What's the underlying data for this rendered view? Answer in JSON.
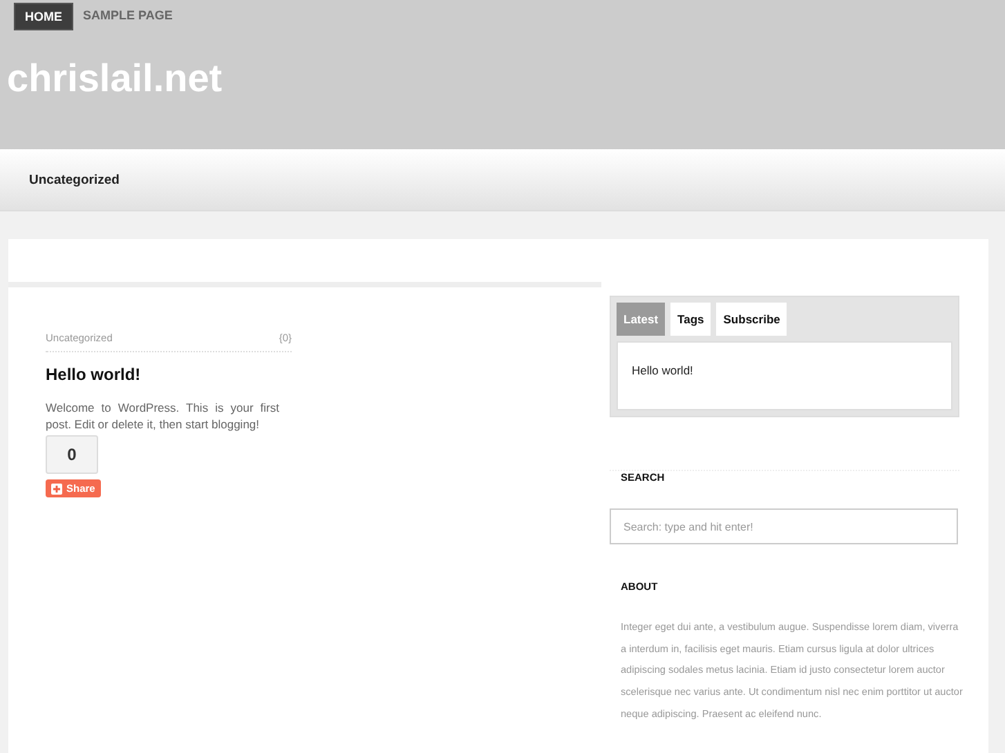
{
  "nav": [
    {
      "label": "HOME",
      "selected": true
    },
    {
      "label": "SAMPLE PAGE",
      "selected": false
    }
  ],
  "site_title": "chrislail.net",
  "category_bar": [
    "Uncategorized"
  ],
  "post": {
    "category": "Uncategorized",
    "comments": "{0}",
    "title": "Hello world!",
    "excerpt": "Welcome to WordPress. This is your first post. Edit or delete it, then start blogging!",
    "count": "0",
    "share": "Share"
  },
  "sidebar": {
    "tabs": [
      {
        "label": "Latest",
        "selected": true
      },
      {
        "label": "Tags",
        "selected": false
      },
      {
        "label": "Subscribe",
        "selected": false
      }
    ],
    "latest": [
      "Hello world!"
    ],
    "search_title": "SEARCH",
    "search_placeholder": "Search: type and hit enter!",
    "about_title": "ABOUT",
    "about_text": "Integer eget dui ante, a vestibulum augue. Suspendisse lorem diam, viverra a interdum in, facilisis eget mauris. Etiam cursus ligula at dolor ultrices adipiscing sodales metus lacinia. Etiam id justo consectetur lorem auctor scelerisque nec varius ante. Ut condimentum nisl nec enim porttitor ut auctor neque adipiscing. Praesent ac eleifend nunc."
  }
}
